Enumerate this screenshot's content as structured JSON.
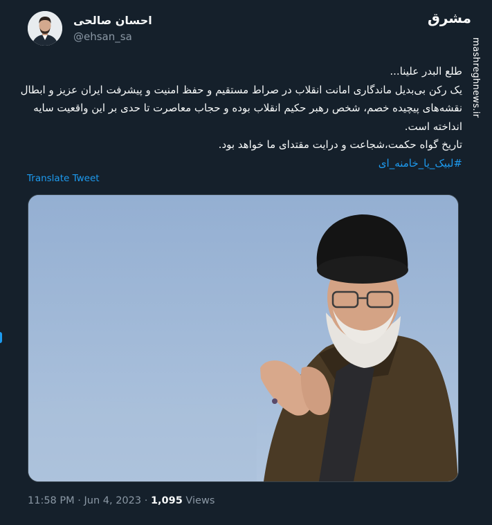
{
  "author": {
    "display_name": "احسان صالحی",
    "handle": "@ehsan_sa"
  },
  "tweet": {
    "lines": [
      "طلع البدر علینا...",
      "یک رکن بی‌بدیل ماندگاری امانت انقلاب در صراط مستقیم و حفظ امنیت و پیشرفت ایران عزیز و ابطال",
      "نقشه‌های پیچیده خصم، شخص رهبر حکیم انقلاب بوده و حجاب معاصرت تا حدی بر این واقعیت سایه",
      "انداخته است.",
      "تاریخ گواه حکمت،شجاعت و درایت مقتدای ما خواهد بود."
    ],
    "hashtag": "#لبیک_یا_خامنه_ای"
  },
  "translate_label": "Translate Tweet",
  "meta": {
    "time": "11:58 PM",
    "separator": "·",
    "date": "Jun 4, 2023",
    "views_count": "1,095",
    "views_label": "Views"
  },
  "watermark": {
    "logo": "مشرق",
    "url": "mashreghnews.ir"
  },
  "colors": {
    "background": "#15202b",
    "accent": "#1d9bf0",
    "muted": "#8b98a5",
    "text": "#f7f9f9"
  }
}
